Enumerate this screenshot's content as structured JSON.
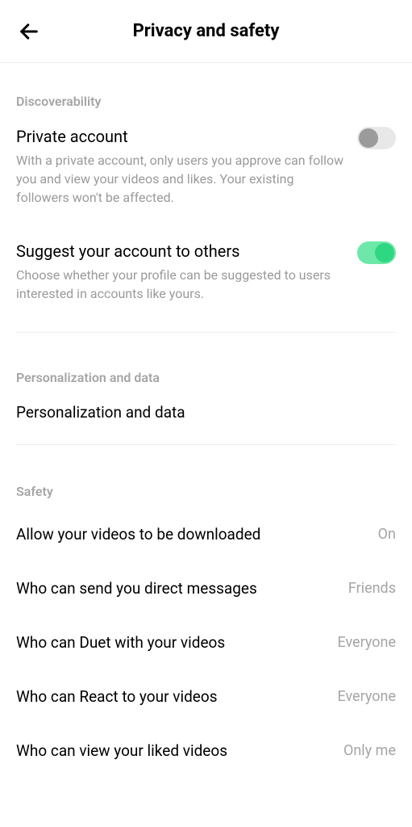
{
  "header": {
    "title": "Privacy and safety"
  },
  "sections": {
    "discoverability": {
      "title": "Discoverability",
      "private_account": {
        "title": "Private account",
        "desc": "With a private account, only users you approve can follow you and view your videos and likes. Your existing followers won't be affected.",
        "enabled": false
      },
      "suggest_account": {
        "title": "Suggest your account to others",
        "desc": "Choose whether your profile can be suggested to users interested in accounts like yours.",
        "enabled": true
      }
    },
    "personalization": {
      "title": "Personalization and data",
      "item_label": "Personalization and data"
    },
    "safety": {
      "title": "Safety",
      "items": [
        {
          "label": "Allow your videos to be downloaded",
          "value": "On"
        },
        {
          "label": "Who can send you direct messages",
          "value": "Friends"
        },
        {
          "label": "Who can Duet with your videos",
          "value": "Everyone"
        },
        {
          "label": "Who can React to your videos",
          "value": "Everyone"
        },
        {
          "label": "Who can view your liked videos",
          "value": "Only me"
        }
      ]
    }
  }
}
